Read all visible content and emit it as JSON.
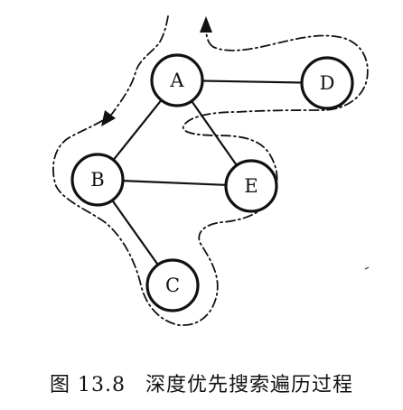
{
  "diagram": {
    "nodes": [
      {
        "id": "A",
        "label": "A"
      },
      {
        "id": "B",
        "label": "B"
      },
      {
        "id": "C",
        "label": "C"
      },
      {
        "id": "D",
        "label": "D"
      },
      {
        "id": "E",
        "label": "E"
      }
    ],
    "edges": [
      {
        "from": "A",
        "to": "B"
      },
      {
        "from": "A",
        "to": "D"
      },
      {
        "from": "A",
        "to": "E"
      },
      {
        "from": "B",
        "to": "E"
      },
      {
        "from": "B",
        "to": "C"
      }
    ]
  },
  "caption": {
    "number": "图 13.8",
    "text": "深度优先搜索遍历过程"
  }
}
